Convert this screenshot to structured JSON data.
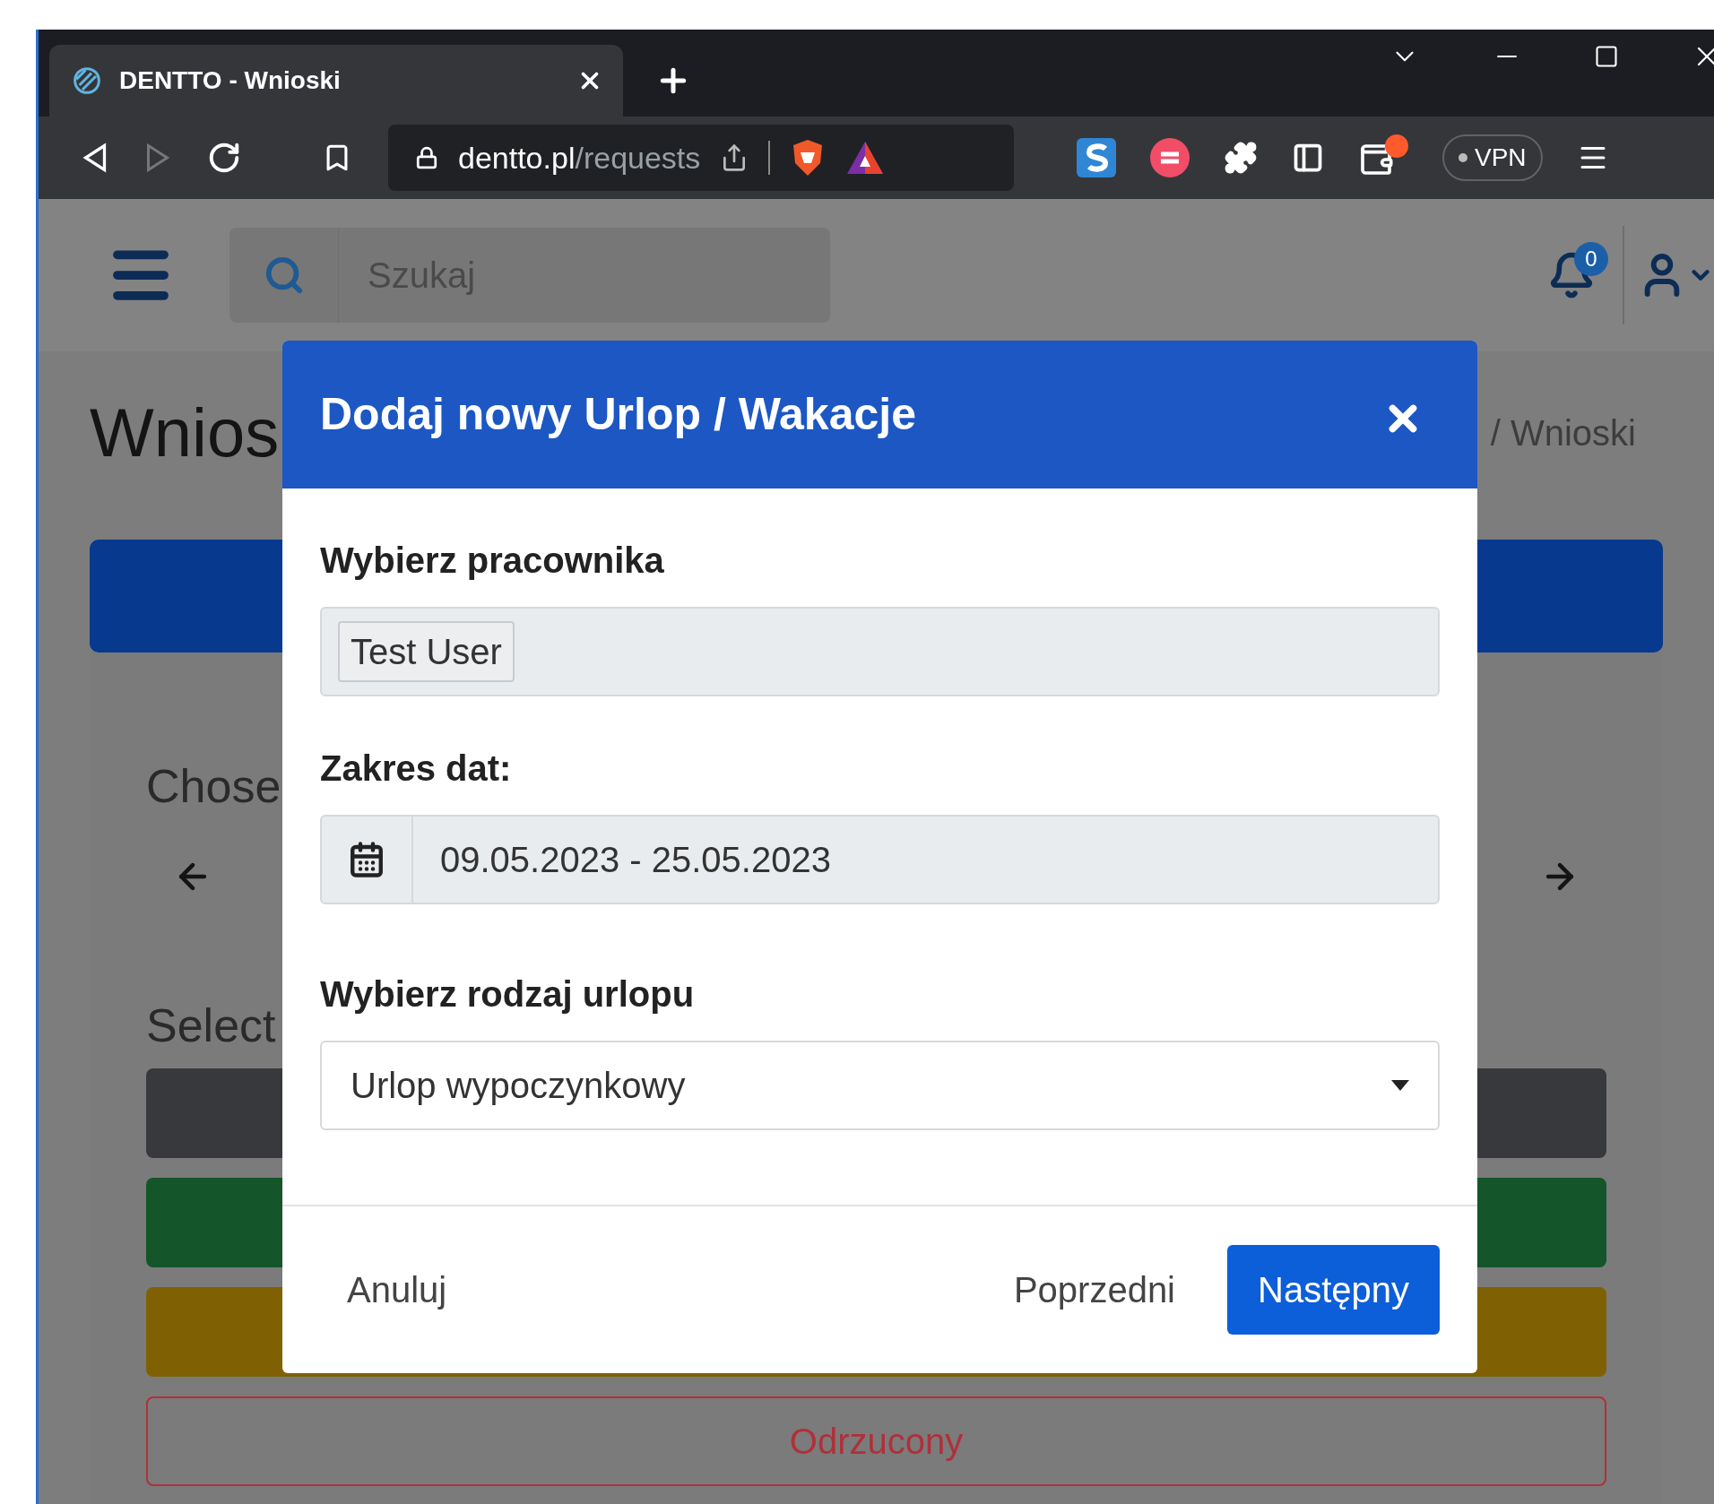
{
  "browser": {
    "tab": {
      "title": "DENTTO - Wnioski"
    },
    "url": {
      "domain": "dentto.pl",
      "path": "/requests"
    },
    "vpn": "VPN",
    "notification_count": "0"
  },
  "page": {
    "search": {
      "placeholder": "Szukaj"
    },
    "title": "Wnios",
    "breadcrumb": "/ Wnioski",
    "chosen_label": "Chose",
    "select_label": "Select",
    "status_bars": [
      {
        "kind": "filled",
        "color": "#38393d"
      },
      {
        "kind": "filled",
        "color": "#14552a"
      },
      {
        "kind": "filled",
        "color": "#7f6104"
      },
      {
        "kind": "outline",
        "color": "#b0303a",
        "label": "Odrzucony"
      }
    ]
  },
  "modal": {
    "title": "Dodaj nowy Urlop / Wakacje",
    "employee": {
      "label": "Wybierz pracownika",
      "value": "Test User"
    },
    "date_range": {
      "label": "Zakres dat:",
      "value": "09.05.2023 - 25.05.2023"
    },
    "leave_type": {
      "label": "Wybierz rodzaj urlopu",
      "value": "Urlop wypoczynkowy"
    },
    "buttons": [
      {
        "label": "Anuluj",
        "kind": "link"
      },
      {
        "label": "Poprzedni",
        "kind": "link"
      },
      {
        "label": "Następny",
        "kind": "primary"
      }
    ]
  }
}
